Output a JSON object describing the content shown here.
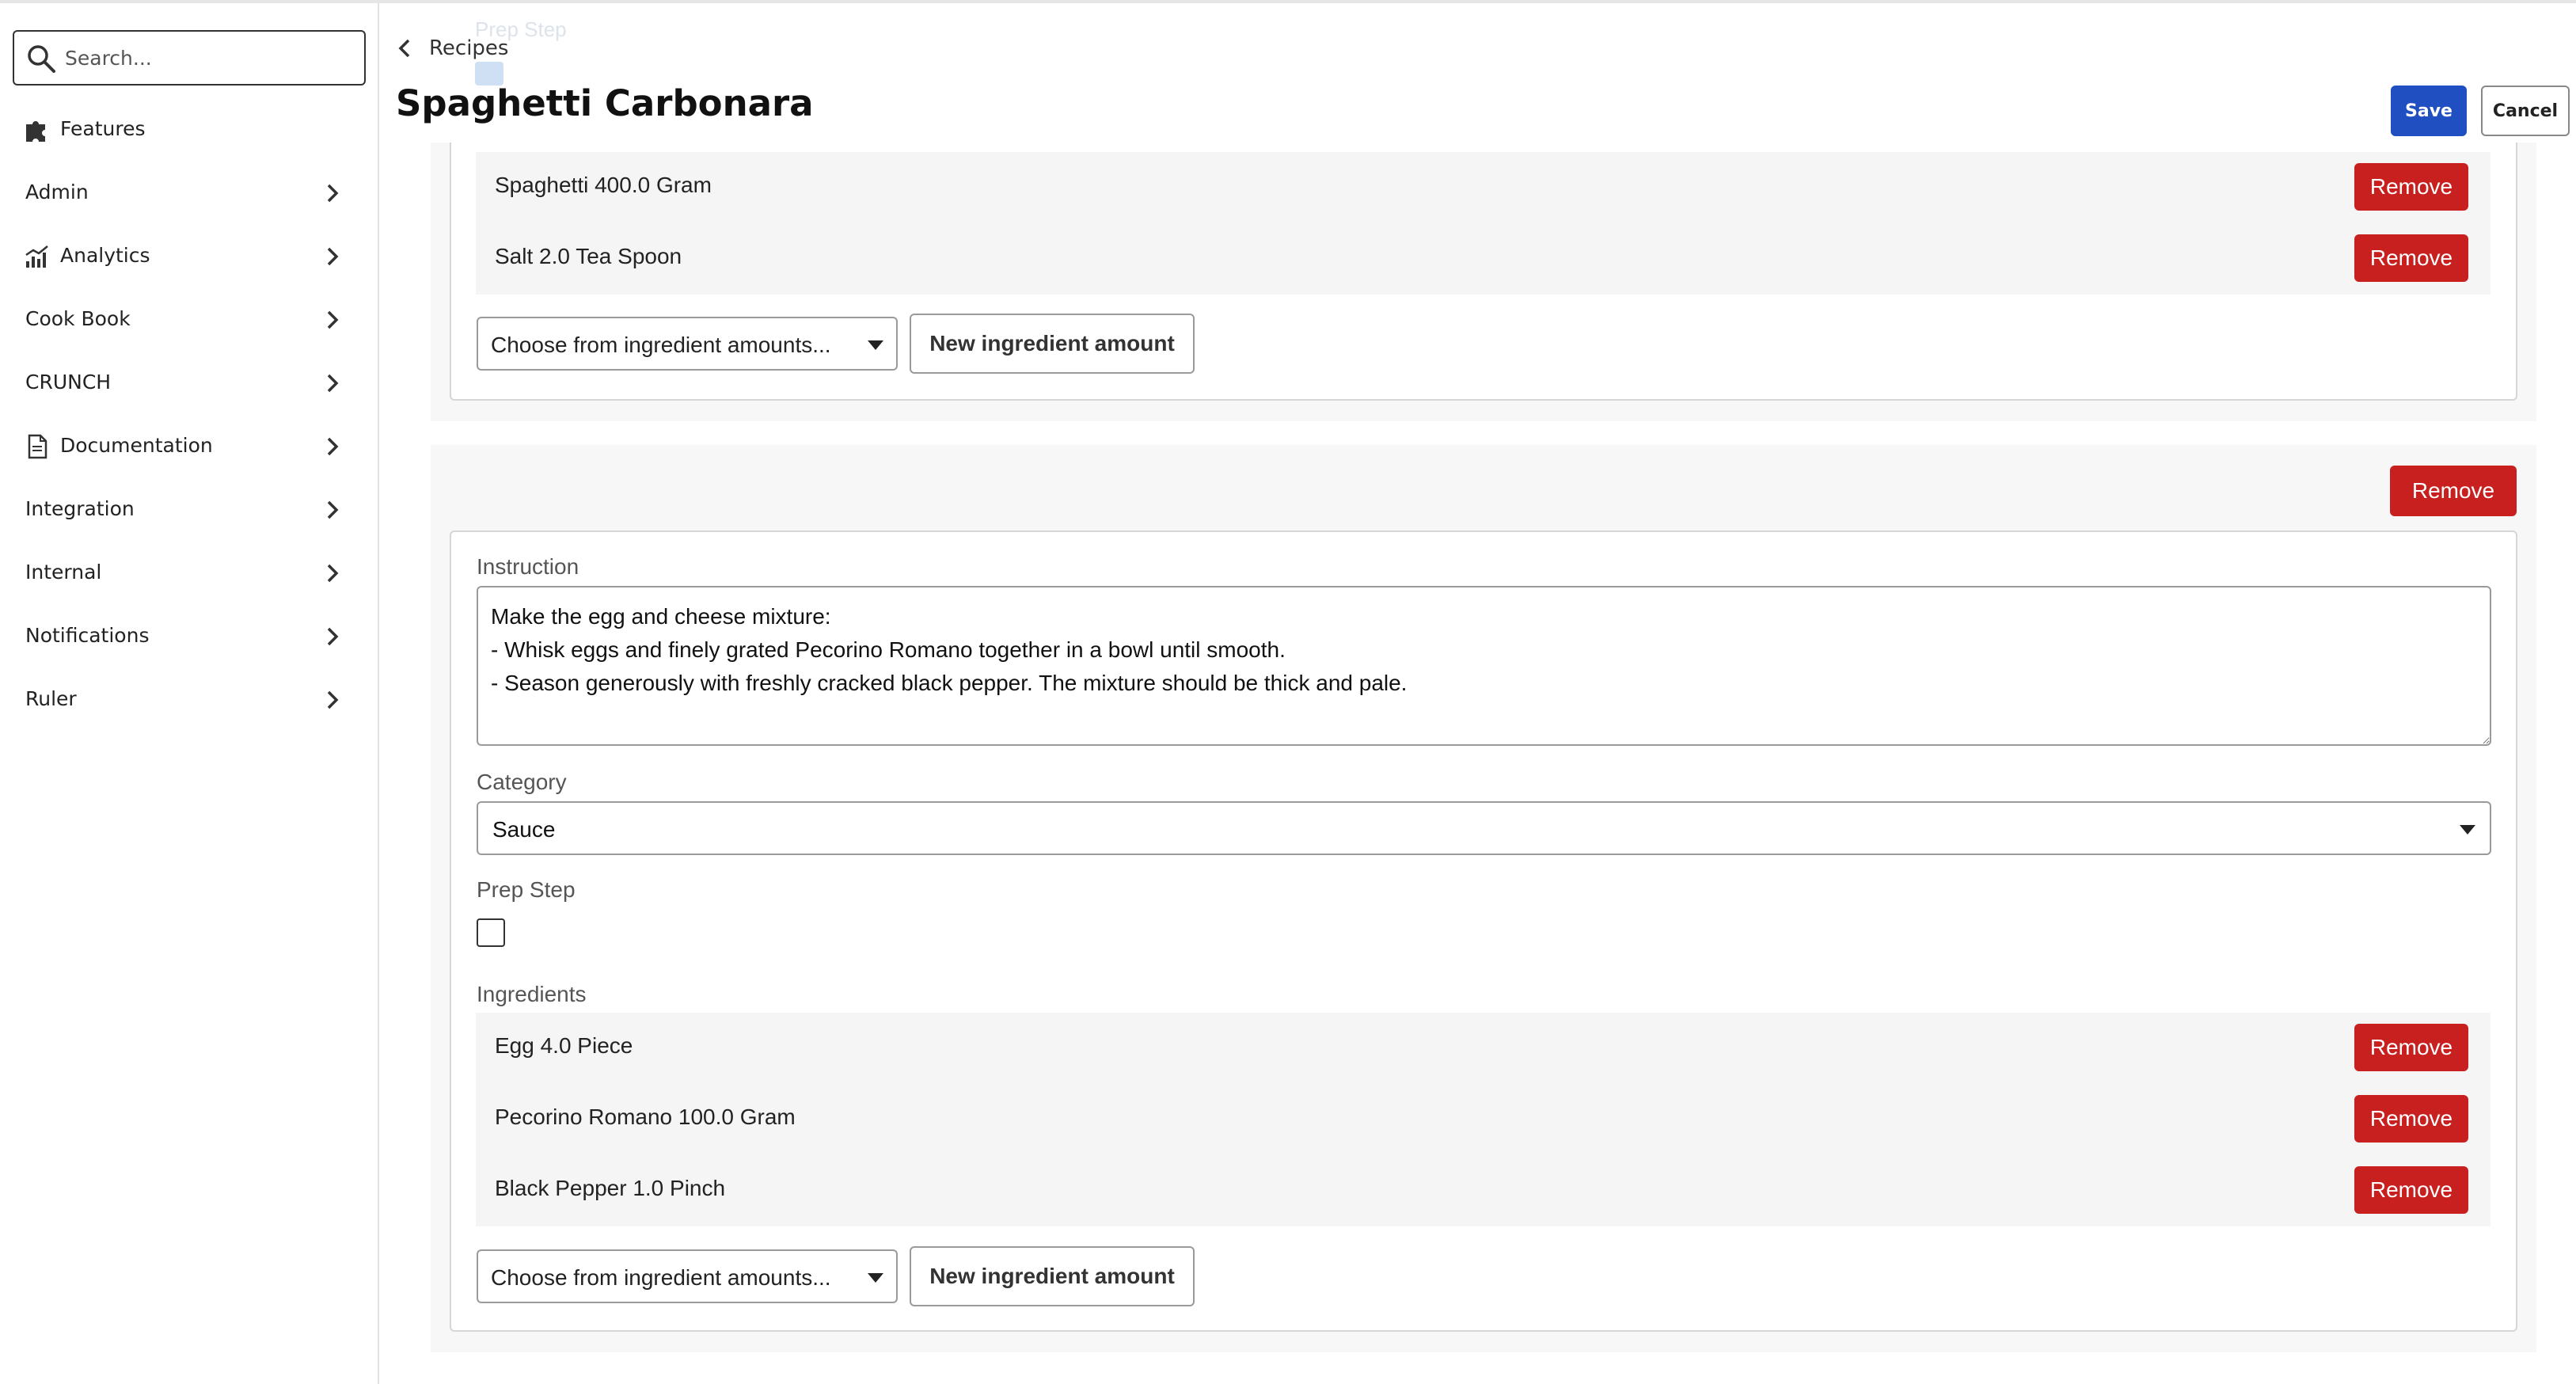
{
  "sidebar": {
    "search_placeholder": "Search...",
    "items": [
      {
        "label": "Features",
        "icon": "puzzle-icon",
        "has_chevron": false
      },
      {
        "label": "Admin",
        "icon": null,
        "has_chevron": true
      },
      {
        "label": "Analytics",
        "icon": "analytics-chart-icon",
        "has_chevron": true
      },
      {
        "label": "Cook Book",
        "icon": null,
        "has_chevron": true
      },
      {
        "label": "CRUNCH",
        "icon": null,
        "has_chevron": true
      },
      {
        "label": "Documentation",
        "icon": "document-icon",
        "has_chevron": true
      },
      {
        "label": "Integration",
        "icon": null,
        "has_chevron": true
      },
      {
        "label": "Internal",
        "icon": null,
        "has_chevron": true
      },
      {
        "label": "Notifications",
        "icon": null,
        "has_chevron": true
      },
      {
        "label": "Ruler",
        "icon": null,
        "has_chevron": true
      }
    ]
  },
  "header": {
    "breadcrumb": "Recipes",
    "title": "Spaghetti Carbonara",
    "save_label": "Save",
    "cancel_label": "Cancel"
  },
  "step_1": {
    "ingredients": [
      {
        "text": "Spaghetti 400.0 Gram",
        "remove_label": "Remove"
      },
      {
        "text": "Salt 2.0 Tea Spoon",
        "remove_label": "Remove"
      }
    ],
    "choose_placeholder": "Choose from ingredient amounts...",
    "new_ingredient_label": "New ingredient amount"
  },
  "step_2": {
    "remove_step_label": "Remove",
    "instruction_label": "Instruction",
    "instruction_text": "Make the egg and cheese mixture:\n- Whisk eggs and finely grated Pecorino Romano together in a bowl until smooth.\n- Season generously with freshly cracked black pepper. The mixture should be thick and pale.",
    "category_label": "Category",
    "category_value": "Sauce",
    "prep_step_label": "Prep Step",
    "prep_step_checked": false,
    "ingredients_label": "Ingredients",
    "ingredients": [
      {
        "text": "Egg 4.0 Piece",
        "remove_label": "Remove"
      },
      {
        "text": "Pecorino Romano 100.0 Gram",
        "remove_label": "Remove"
      },
      {
        "text": "Black Pepper 1.0 Pinch",
        "remove_label": "Remove"
      }
    ],
    "choose_placeholder": "Choose from ingredient amounts...",
    "new_ingredient_label": "New ingredient amount"
  },
  "colors": {
    "primary": "#1f4fc0",
    "danger": "#c81f1f",
    "panel_bg": "#f7f7f7"
  }
}
